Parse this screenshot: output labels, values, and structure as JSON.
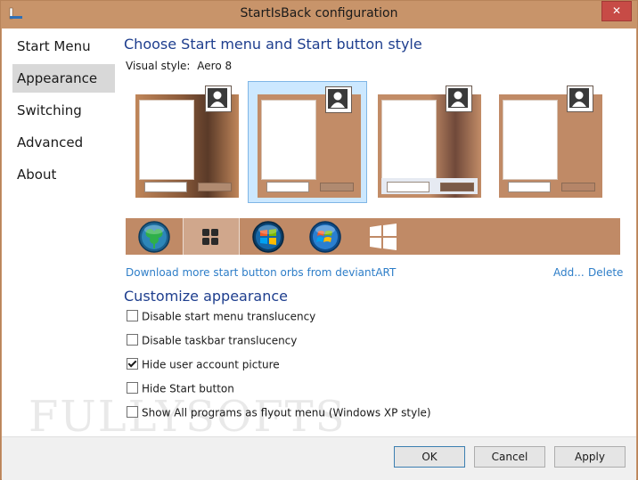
{
  "window": {
    "title": "StartIsBack configuration",
    "close_glyph": "✕"
  },
  "sidebar": {
    "items": [
      {
        "label": "Start Menu",
        "selected": false
      },
      {
        "label": "Appearance",
        "selected": true
      },
      {
        "label": "Switching",
        "selected": false
      },
      {
        "label": "Advanced",
        "selected": false
      },
      {
        "label": "About",
        "selected": false
      }
    ]
  },
  "main": {
    "heading": "Choose Start menu and Start button style",
    "visual_style_label": "Visual style:",
    "visual_style_value": "Aero 8",
    "style_tiles": [
      {
        "name": "style-1",
        "selected": false
      },
      {
        "name": "style-2",
        "selected": true
      },
      {
        "name": "style-3",
        "selected": false
      },
      {
        "name": "style-4",
        "selected": false
      }
    ],
    "orbs": [
      {
        "name": "clover-orb",
        "selected": false
      },
      {
        "name": "windows8-tiles-orb",
        "selected": true
      },
      {
        "name": "windows-vista-orb",
        "selected": false
      },
      {
        "name": "windows7-orb",
        "selected": false
      },
      {
        "name": "windows8-logo-orb",
        "selected": false
      }
    ],
    "download_link": "Download more start button orbs from deviantART",
    "add_link": "Add...",
    "delete_link": "Delete",
    "customize_heading": "Customize appearance",
    "options": [
      {
        "label": "Disable start menu translucency",
        "checked": false
      },
      {
        "label": "Disable taskbar translucency",
        "checked": false
      },
      {
        "label": "Hide user account picture",
        "checked": true
      },
      {
        "label": "Hide Start button",
        "checked": false
      },
      {
        "label": "Show All programs as flyout menu (Windows XP style)",
        "checked": false
      }
    ],
    "watermark": "FULLYSOFTS"
  },
  "footer": {
    "ok_label": "OK",
    "cancel_label": "Cancel",
    "apply_label": "Apply"
  },
  "colors": {
    "accent": "#1e3e8e",
    "link": "#2e7ec8",
    "chrome": "#c8946a",
    "selection": "#cce8ff"
  }
}
